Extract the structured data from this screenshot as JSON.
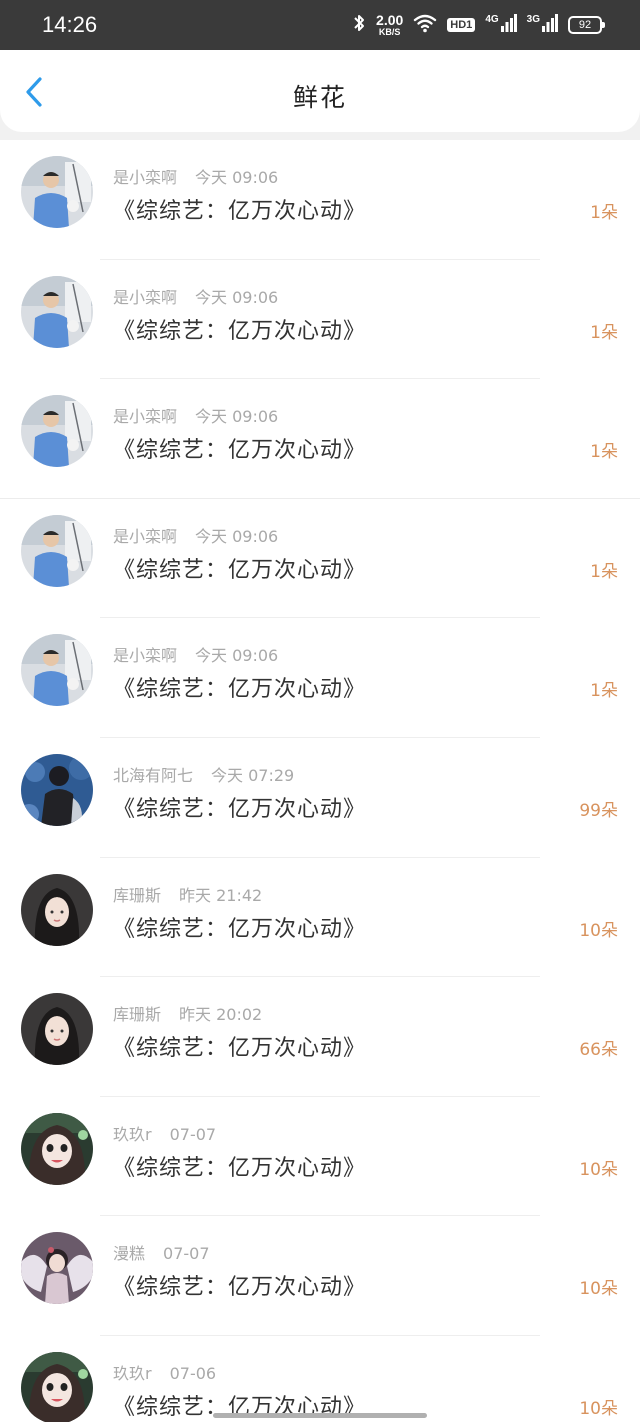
{
  "status_bar": {
    "time": "14:26",
    "net_speed": "2.00",
    "net_speed_unit": "KB/S",
    "hd_badge": "HD1",
    "sig1_label": "4G",
    "sig2_label": "3G",
    "battery": "92"
  },
  "header": {
    "title": "鲜花"
  },
  "list": [
    {
      "name": "是小栾啊",
      "time": "今天 09:06",
      "book": "《综综艺：亿万次心动》",
      "count": "1朵",
      "avatar": "man"
    },
    {
      "name": "是小栾啊",
      "time": "今天 09:06",
      "book": "《综综艺：亿万次心动》",
      "count": "1朵",
      "avatar": "man"
    },
    {
      "name": "是小栾啊",
      "time": "今天 09:06",
      "book": "《综综艺：亿万次心动》",
      "count": "1朵",
      "avatar": "man"
    },
    {
      "name": "是小栾啊",
      "time": "今天 09:06",
      "book": "《综综艺：亿万次心动》",
      "count": "1朵",
      "avatar": "man"
    },
    {
      "name": "是小栾啊",
      "time": "今天 09:06",
      "book": "《综综艺：亿万次心动》",
      "count": "1朵",
      "avatar": "man"
    },
    {
      "name": "北海有阿七",
      "time": "今天 07:29",
      "book": "《综综艺：亿万次心动》",
      "count": "99朵",
      "avatar": "blue"
    },
    {
      "name": "库珊斯",
      "time": "昨天 21:42",
      "book": "《综综艺：亿万次心动》",
      "count": "10朵",
      "avatar": "girl-dark"
    },
    {
      "name": "库珊斯",
      "time": "昨天 20:02",
      "book": "《综综艺：亿万次心动》",
      "count": "66朵",
      "avatar": "girl-dark"
    },
    {
      "name": "玖玖r",
      "time": "07-07",
      "book": "《综综艺：亿万次心动》",
      "count": "10朵",
      "avatar": "girl-green"
    },
    {
      "name": "漫糕",
      "time": "07-07",
      "book": "《综综艺：亿万次心动》",
      "count": "10朵",
      "avatar": "girl-wings"
    },
    {
      "name": "玖玖r",
      "time": "07-06",
      "book": "《综综艺：亿万次心动》",
      "count": "10朵",
      "avatar": "girl-green"
    }
  ],
  "colors": {
    "accent_blue": "#2e9bea",
    "count_orange": "#d8935e",
    "meta_gray": "#a9a9a9",
    "status_bar": "#3a3a3a"
  }
}
